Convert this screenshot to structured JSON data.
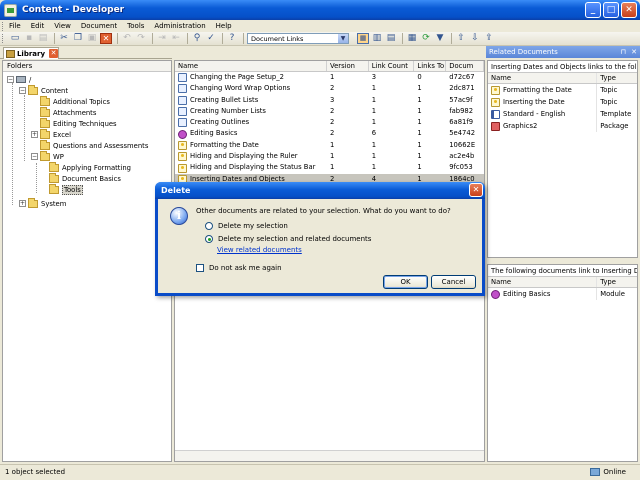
{
  "window": {
    "title": "Content - Developer"
  },
  "menu": [
    "File",
    "Edit",
    "View",
    "Document",
    "Tools",
    "Administration",
    "Help"
  ],
  "toolbar": {
    "combo_value": "Document Links"
  },
  "library_tab": {
    "label": "Library"
  },
  "folders": {
    "header": "Folders",
    "items": [
      {
        "label": "/",
        "level": 0
      },
      {
        "label": "Content",
        "level": 1
      },
      {
        "label": "Additional Topics",
        "level": 2
      },
      {
        "label": "Attachments",
        "level": 2
      },
      {
        "label": "Editing Techniques",
        "level": 2
      },
      {
        "label": "Excel",
        "level": 2
      },
      {
        "label": "Questions and Assessments",
        "level": 2
      },
      {
        "label": "WP",
        "level": 2
      },
      {
        "label": "Applying Formatting",
        "level": 3
      },
      {
        "label": "Document Basics",
        "level": 3
      },
      {
        "label": "Tools",
        "level": 3
      },
      {
        "label": "System",
        "level": 1
      }
    ]
  },
  "list": {
    "columns": [
      "Name",
      "Version",
      "Link Count",
      "Links To",
      "Docum"
    ],
    "rows": [
      {
        "name": "Changing the Page Setup_2",
        "version": "1",
        "link_count": "3",
        "links_to": "0",
        "doc": "d72c67",
        "icon": "doc"
      },
      {
        "name": "Changing Word Wrap Options",
        "version": "2",
        "link_count": "1",
        "links_to": "1",
        "doc": "2dc871",
        "icon": "doc"
      },
      {
        "name": "Creating Bullet Lists",
        "version": "3",
        "link_count": "1",
        "links_to": "1",
        "doc": "57ac9f",
        "icon": "doc"
      },
      {
        "name": "Creating Number Lists",
        "version": "2",
        "link_count": "1",
        "links_to": "1",
        "doc": "fab982",
        "icon": "doc"
      },
      {
        "name": "Creating Outlines",
        "version": "2",
        "link_count": "1",
        "links_to": "1",
        "doc": "6a81f9",
        "icon": "doc"
      },
      {
        "name": "Editing Basics",
        "version": "2",
        "link_count": "6",
        "links_to": "1",
        "doc": "5e4742",
        "icon": "module"
      },
      {
        "name": "Formatting the Date",
        "version": "1",
        "link_count": "1",
        "links_to": "1",
        "doc": "10662E",
        "icon": "topic"
      },
      {
        "name": "Hiding and Displaying the Ruler",
        "version": "1",
        "link_count": "1",
        "links_to": "1",
        "doc": "ac2e4b",
        "icon": "topic"
      },
      {
        "name": "Hiding and Displaying the Status Bar",
        "version": "1",
        "link_count": "1",
        "links_to": "1",
        "doc": "9fc053",
        "icon": "topic"
      },
      {
        "name": "Inserting Dates and Objects",
        "version": "2",
        "link_count": "4",
        "links_to": "1",
        "doc": "1864c0",
        "icon": "topic"
      }
    ]
  },
  "related_panel": {
    "title": "Related Documents",
    "top_caption": "Inserting Dates and Objects links to the follo...",
    "columns": [
      "Name",
      "Type"
    ],
    "top_rows": [
      {
        "name": "Formatting the Date",
        "type": "Topic",
        "icon": "topic"
      },
      {
        "name": "Inserting the Date",
        "type": "Topic",
        "icon": "topic"
      },
      {
        "name": "Standard - English",
        "type": "Template",
        "icon": "template"
      },
      {
        "name": "Graphics2",
        "type": "Package",
        "icon": "package"
      }
    ],
    "bottom_caption": "The following documents link to Inserting Dat...",
    "bottom_rows": [
      {
        "name": "Editing Basics",
        "type": "Module",
        "icon": "module"
      }
    ]
  },
  "dialog": {
    "title": "Delete",
    "message": "Other documents are related to your selection. What do you want to do?",
    "option1": "Delete my selection",
    "option2": "Delete my selection and related documents",
    "link": "View related documents",
    "checkbox": "Do not ask me again",
    "ok": "OK",
    "cancel": "Cancel"
  },
  "status": {
    "left": "1 object selected",
    "right": "Online"
  }
}
